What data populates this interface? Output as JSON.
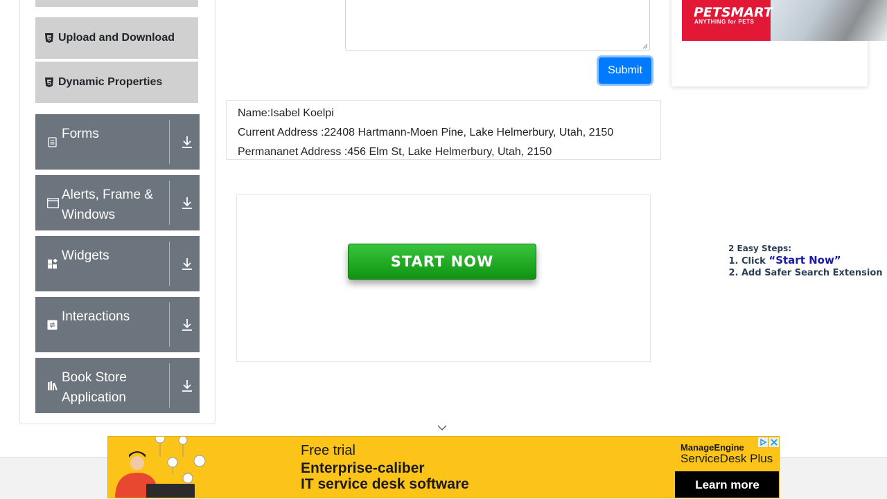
{
  "sidebar": {
    "sub_items": [
      {
        "label": "Upload and Download",
        "icon": "html5-shield-icon"
      },
      {
        "label": "Dynamic Properties",
        "icon": "html5-shield-icon"
      }
    ],
    "groups": [
      {
        "label": "Forms",
        "icon": "document-icon"
      },
      {
        "label": "Alerts, Frame & Windows",
        "icon": "window-icon"
      },
      {
        "label": "Widgets",
        "icon": "widgets-icon"
      },
      {
        "label": "Interactions",
        "icon": "interaction-icon"
      },
      {
        "label": "Book Store Application",
        "icon": "books-icon"
      }
    ]
  },
  "form": {
    "submit_label": "Submit"
  },
  "output": {
    "name": "Name:Isabel Koelpi",
    "current_address": "Current Address :22408 Hartmann-Moen Pine, Lake Helmerbury, Utah, 2150",
    "permanent_address": "Permananet Address :456 Elm St, Lake Helmerbury, Utah, 2150"
  },
  "ads": {
    "start_now": "START NOW",
    "petsmart_brand": "PETSMART",
    "petsmart_tag": "ANYTHING for PETS",
    "steps_title": "2 Easy Steps:",
    "step1_prefix": "Click",
    "step1_highlight": "“Start Now”",
    "step2": "Add Safer Search Extension",
    "bottom_line1": "Free trial",
    "bottom_line2": "Enterprise-caliber",
    "bottom_line3": "IT service desk software",
    "bottom_brand1": "ManageEngine",
    "bottom_brand2": "ServiceDesk Plus",
    "bottom_cta": "Learn more"
  },
  "colors": {
    "primary": "#007bff",
    "group_bg": "#6c757d",
    "sub_item_bg": "#d0d0d0",
    "ad_yellow": "#fcc418",
    "petsmart_red": "#e31837",
    "start_green": "#1aa61d"
  }
}
